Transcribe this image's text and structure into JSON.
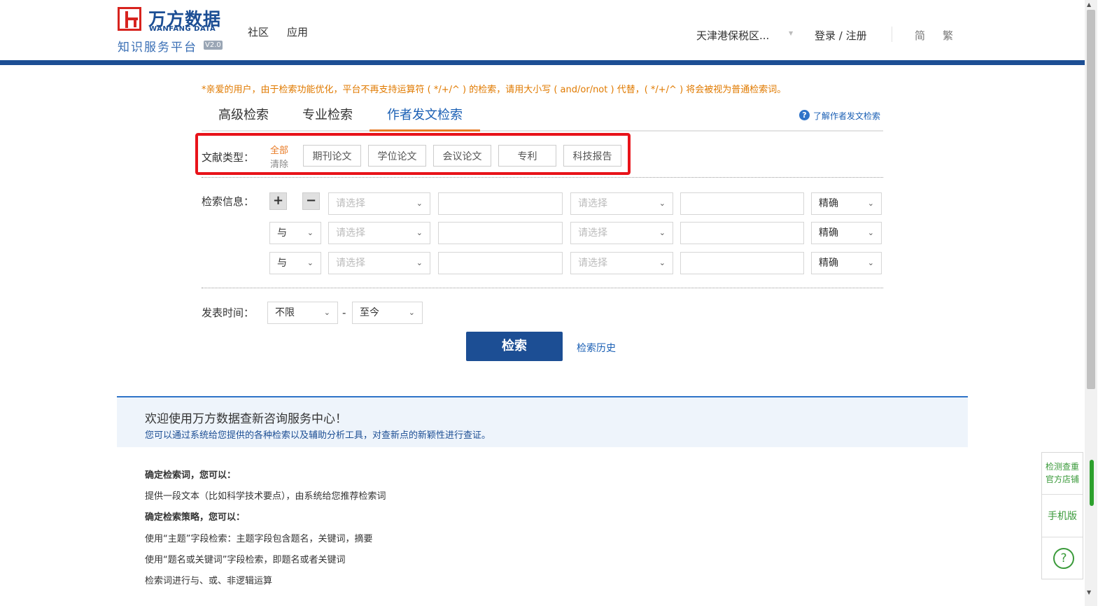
{
  "header": {
    "logo_cn": "万方数据",
    "logo_en": "WANFANG DATA",
    "logo_sub": "知识服务平台",
    "logo_version": "V2.0",
    "nav": [
      "社区",
      "应用"
    ],
    "region": "天津港保税区...",
    "login": "登录 / 注册",
    "lang_simplified": "简",
    "lang_traditional": "繁"
  },
  "notice": "*亲爱的用户，由于检索功能优化，平台不再支持运算符 ( */+/^ ) 的检索，请用大小写 ( and/or/not ) 代替，( */+/^ ) 将会被视为普通检索词。",
  "tabs": [
    "高级检索",
    "专业检索",
    "作者发文检索"
  ],
  "active_tab": "作者发文检索",
  "help_link": "了解作者发文检索",
  "doc_type": {
    "label": "文献类型：",
    "all": "全部",
    "clear": "清除",
    "buttons": [
      "期刊论文",
      "学位论文",
      "会议论文",
      "专利",
      "科技报告"
    ]
  },
  "search_info": {
    "label": "检索信息：",
    "add_symbol": "+",
    "remove_symbol": "−",
    "rows": [
      {
        "logic": "",
        "field1": "请选择",
        "field2": "请选择",
        "match": "精确"
      },
      {
        "logic": "与",
        "field1": "请选择",
        "field2": "请选择",
        "match": "精确"
      },
      {
        "logic": "与",
        "field1": "请选择",
        "field2": "请选择",
        "match": "精确"
      }
    ]
  },
  "time": {
    "label": "发表时间：",
    "from": "不限",
    "dash": "-",
    "to": "至今"
  },
  "search_button": "检索",
  "history_link": "检索历史",
  "welcome": {
    "title": "欢迎使用万方数据查新咨询服务中心！",
    "desc": "您可以通过系统给您提供的各种检索以及辅助分析工具，对查新点的新颖性进行查证。"
  },
  "info_lines": [
    "确定检索词，您可以：",
    "提供一段文本（比如科学技术要点），由系统给您推荐检索词",
    "确定检索策略，您可以：",
    "使用“主题”字段检索：主题字段包含题名，关键词，摘要",
    "使用“题名或关键词”字段检索，即题名或者关键词",
    "检索词进行与、或、非逻辑运算"
  ],
  "side_panel": {
    "shop_line1": "检测查重",
    "shop_line2": "官方店铺",
    "mobile": "手机版",
    "help_symbol": "?"
  },
  "colors": {
    "brand_blue": "#1c4e94",
    "accent_orange": "#e87a24",
    "highlight_red": "#e8131a",
    "side_green": "#3a9a3a"
  }
}
